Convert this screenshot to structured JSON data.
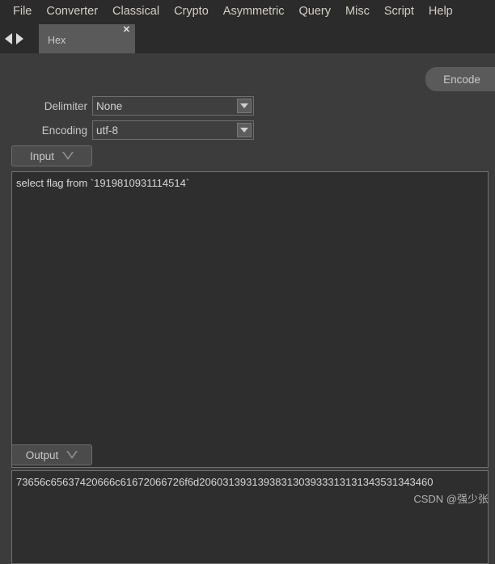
{
  "menubar": {
    "items": [
      {
        "label": "File"
      },
      {
        "label": "Converter"
      },
      {
        "label": "Classical"
      },
      {
        "label": "Crypto"
      },
      {
        "label": "Asymmetric"
      },
      {
        "label": "Query"
      },
      {
        "label": "Misc"
      },
      {
        "label": "Script"
      },
      {
        "label": "Help"
      }
    ]
  },
  "tabstrip": {
    "prev_icon": "left-arrow-icon",
    "next_icon": "right-arrow-icon",
    "tabs": [
      {
        "label": "Hex",
        "close_label": "✕"
      }
    ]
  },
  "toolbar": {
    "encode_label": "Encode"
  },
  "options": {
    "delimiter": {
      "label": "Delimiter",
      "value": "None",
      "arrow_icon": "chevron-down-icon"
    },
    "encoding": {
      "label": "Encoding",
      "value": "utf-8",
      "arrow_icon": "chevron-down-icon"
    }
  },
  "input_section": {
    "label": "Input",
    "arrow_icon": "triangle-down-outline-icon",
    "value": "select flag from `1919810931114514`"
  },
  "output_section": {
    "label": "Output",
    "arrow_icon": "triangle-down-outline-icon",
    "value": "73656c65637420666c61672066726f6d2060313931393831303933313131343531343460"
  },
  "watermark": {
    "text": "CSDN @强少张"
  },
  "colors": {
    "window_background": "#3c3c3c",
    "menubar_background": "#2b2b2b",
    "menu_text": "#d6cfc2",
    "tab_active": "#5a5a5a",
    "field_background": "#3f3f3f",
    "textarea_background": "#2e2e2e",
    "border": "#707070",
    "text": "#d2d2d2"
  }
}
